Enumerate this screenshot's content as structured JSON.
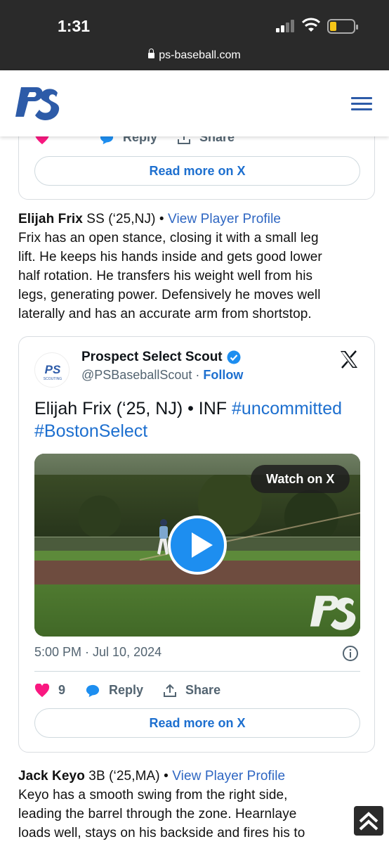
{
  "status_bar": {
    "time": "1:31",
    "url": "ps-baseball.com"
  },
  "site": {
    "logo_text": "PS",
    "brand_color": "#2d5ba8"
  },
  "top_card": {
    "reply_label": "Reply",
    "share_label": "Share",
    "read_more": "Read more on X"
  },
  "players": [
    {
      "name": "Elijah Frix",
      "meta": " SS (‘25,NJ) • ",
      "link": "View Player Profile",
      "lines": [
        "Frix has an open stance, closing it with a small leg",
        "lift. He keeps his hands inside and gets good lower",
        "half rotation. He transfers his weight well from his",
        "legs, generating power. Defensively he moves well",
        "laterally and has an accurate arm from shortstop."
      ]
    },
    {
      "name": "Jack Keyo",
      "meta": " 3B (‘25,MA) • ",
      "link": "View Player Profile",
      "lines": [
        "Keyo has a smooth swing from the right side,",
        "leading the barrel through the zone. Hearnlaye",
        "loads well, stays on his backside and fires his to"
      ]
    }
  ],
  "tweet": {
    "account_name": "Prospect Select Scout",
    "handle": "@PSBaseballScout",
    "separator": " · ",
    "follow": "Follow",
    "text_plain": "Elijah Frix (‘25, NJ) • INF ",
    "tag1": "#uncommitted",
    "tag2": "#BostonSelect",
    "watch_label": "Watch on X",
    "date": "5:00 PM · Jul 10, 2024",
    "likes": "9",
    "reply_label": "Reply",
    "share_label": "Share",
    "read_more": "Read more on X",
    "avatar_text": "PS",
    "avatar_sub": "SCOUTING"
  },
  "colors": {
    "link_blue": "#2e66c2",
    "x_blue": "#1d6fcf",
    "heart_pink": "#f91880"
  }
}
